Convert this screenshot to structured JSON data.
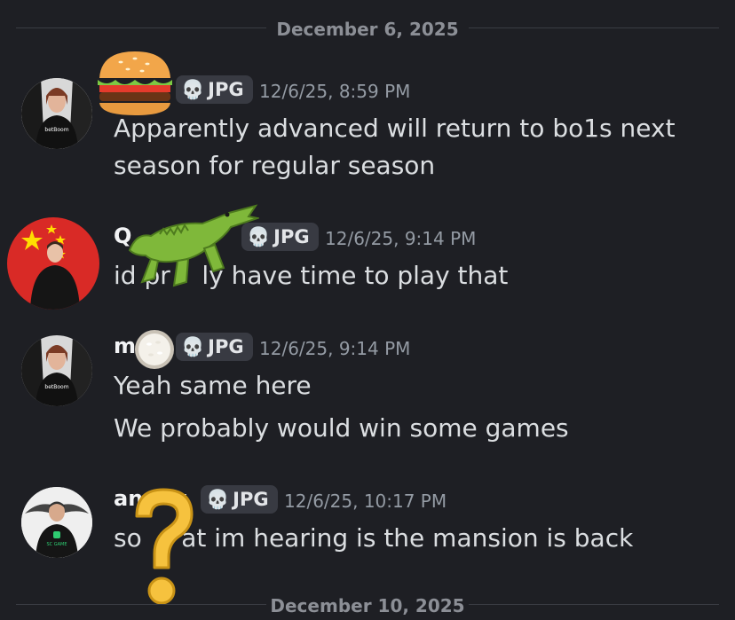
{
  "dividers": [
    "December 6, 2025",
    "December 10, 2025"
  ],
  "messages": [
    {
      "author": "",
      "tag": "JPG",
      "timestamp": "12/6/25, 8:59 PM",
      "lines": [
        "Apparently advanced will return to bo1s next",
        "season for regular season"
      ],
      "avatar_label": "betBoom",
      "decoration": "hamburger-emoji"
    },
    {
      "author": "Q",
      "tag": "JPG",
      "timestamp": "12/6/25, 9:14 PM",
      "lines": [
        "id pr    ly have time to play that"
      ],
      "decoration": "crocodile-emoji"
    },
    {
      "author": "m",
      "tag": "JPG",
      "timestamp": "12/6/25, 9:14 PM",
      "lines": [
        "Yeah same here",
        "We probably would win some games"
      ],
      "avatar_label": "betBoom",
      "decoration": "rice-emoji"
    },
    {
      "author": "an    y",
      "tag": "JPG",
      "timestamp": "12/6/25, 10:17 PM",
      "lines": [
        "so     at im hearing is the mansion is back"
      ],
      "avatar_label": "SC GAME",
      "decoration": "question-mark-emoji"
    }
  ],
  "colors": {
    "background": "#1e1f24",
    "tag_bg": "#383a42",
    "timestamp": "#949ba4"
  }
}
